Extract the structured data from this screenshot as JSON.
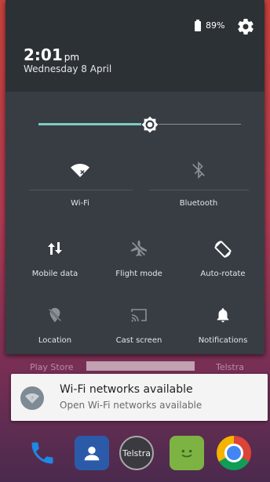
{
  "status": {
    "battery_text": "89%"
  },
  "header": {
    "time": "2:01",
    "ampm": "pm",
    "date": "Wednesday 8 April"
  },
  "brightness": {
    "level": 0.55
  },
  "tiles": {
    "wifi": {
      "label": "Wi-Fi",
      "icon": "wifi-icon",
      "active": true
    },
    "bluetooth": {
      "label": "Bluetooth",
      "icon": "bluetooth-off-icon",
      "active": false
    },
    "mobile_data": {
      "label": "Mobile data",
      "icon": "mobile-data-icon",
      "active": true
    },
    "flight_mode": {
      "label": "Flight mode",
      "icon": "airplane-off-icon",
      "active": false
    },
    "auto_rotate": {
      "label": "Auto-rotate",
      "icon": "auto-rotate-icon",
      "active": true
    },
    "location": {
      "label": "Location",
      "icon": "location-off-icon",
      "active": false
    },
    "cast_screen": {
      "label": "Cast screen",
      "icon": "cast-icon",
      "active": false
    },
    "notifications": {
      "label": "Notifications",
      "icon": "bell-icon",
      "active": true
    }
  },
  "home_labels": {
    "left": "Play Store",
    "right": "Telstra"
  },
  "notification": {
    "title": "Wi-Fi networks available",
    "subtitle": "Open Wi-Fi networks available"
  },
  "dock": {
    "telstra_label": "Telstra"
  },
  "colors": {
    "shade": "#373d43",
    "header": "#2c3136",
    "accent": "#7fc9c4",
    "active_icon": "#ffffff",
    "inactive_icon": "#8a9095"
  }
}
